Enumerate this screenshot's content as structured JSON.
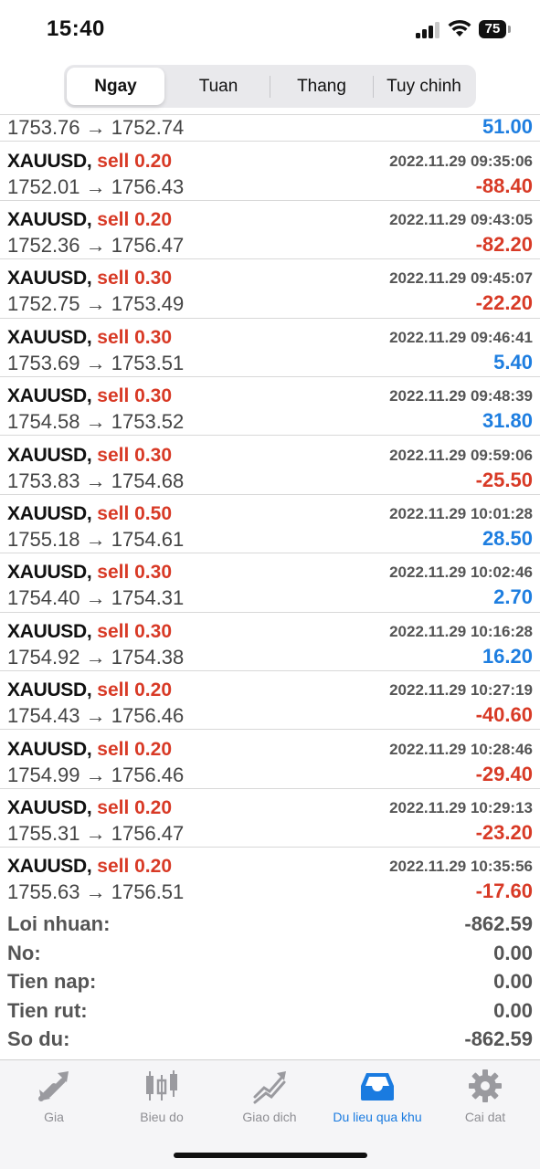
{
  "status": {
    "time": "15:40",
    "battery": "75"
  },
  "segments": [
    "Ngay",
    "Tuan",
    "Thang",
    "Tuy chinh"
  ],
  "partial_row": {
    "prices": "1753.76 → 1752.74",
    "profit": "51.00"
  },
  "deals": [
    {
      "symbol": "XAUUSD,",
      "side": "sell 0.20",
      "time": "2022.11.29 09:35:06",
      "prices": "1752.01 → 1756.43",
      "profit": "-88.40",
      "positive": false
    },
    {
      "symbol": "XAUUSD,",
      "side": "sell 0.20",
      "time": "2022.11.29 09:43:05",
      "prices": "1752.36 → 1756.47",
      "profit": "-82.20",
      "positive": false
    },
    {
      "symbol": "XAUUSD,",
      "side": "sell 0.30",
      "time": "2022.11.29 09:45:07",
      "prices": "1752.75 → 1753.49",
      "profit": "-22.20",
      "positive": false
    },
    {
      "symbol": "XAUUSD,",
      "side": "sell 0.30",
      "time": "2022.11.29 09:46:41",
      "prices": "1753.69 → 1753.51",
      "profit": "5.40",
      "positive": true
    },
    {
      "symbol": "XAUUSD,",
      "side": "sell 0.30",
      "time": "2022.11.29 09:48:39",
      "prices": "1754.58 → 1753.52",
      "profit": "31.80",
      "positive": true
    },
    {
      "symbol": "XAUUSD,",
      "side": "sell 0.30",
      "time": "2022.11.29 09:59:06",
      "prices": "1753.83 → 1754.68",
      "profit": "-25.50",
      "positive": false
    },
    {
      "symbol": "XAUUSD,",
      "side": "sell 0.50",
      "time": "2022.11.29 10:01:28",
      "prices": "1755.18 → 1754.61",
      "profit": "28.50",
      "positive": true
    },
    {
      "symbol": "XAUUSD,",
      "side": "sell 0.30",
      "time": "2022.11.29 10:02:46",
      "prices": "1754.40 → 1754.31",
      "profit": "2.70",
      "positive": true
    },
    {
      "symbol": "XAUUSD,",
      "side": "sell 0.30",
      "time": "2022.11.29 10:16:28",
      "prices": "1754.92 → 1754.38",
      "profit": "16.20",
      "positive": true
    },
    {
      "symbol": "XAUUSD,",
      "side": "sell 0.20",
      "time": "2022.11.29 10:27:19",
      "prices": "1754.43 → 1756.46",
      "profit": "-40.60",
      "positive": false
    },
    {
      "symbol": "XAUUSD,",
      "side": "sell 0.20",
      "time": "2022.11.29 10:28:46",
      "prices": "1754.99 → 1756.46",
      "profit": "-29.40",
      "positive": false
    },
    {
      "symbol": "XAUUSD,",
      "side": "sell 0.20",
      "time": "2022.11.29 10:29:13",
      "prices": "1755.31 → 1756.47",
      "profit": "-23.20",
      "positive": false
    },
    {
      "symbol": "XAUUSD,",
      "side": "sell 0.20",
      "time": "2022.11.29 10:35:56",
      "prices": "1755.63 → 1756.51",
      "profit": "-17.60",
      "positive": false
    }
  ],
  "summary": [
    {
      "label": "Loi nhuan:",
      "value": "-862.59"
    },
    {
      "label": "No:",
      "value": "0.00"
    },
    {
      "label": "Tien nap:",
      "value": "0.00"
    },
    {
      "label": "Tien rut:",
      "value": "0.00"
    },
    {
      "label": "So du:",
      "value": "-862.59"
    }
  ],
  "tabs": [
    {
      "label": "Gia",
      "icon": "price-arrows-icon"
    },
    {
      "label": "Bieu do",
      "icon": "candlestick-icon"
    },
    {
      "label": "Giao dich",
      "icon": "trade-chart-icon"
    },
    {
      "label": "Du lieu qua khu",
      "icon": "history-tray-icon"
    },
    {
      "label": "Cai dat",
      "icon": "gear-icon"
    }
  ],
  "colors": {
    "positive": "#1e7ee0",
    "negative": "#d83a26",
    "active_tab": "#1a7be0",
    "inactive_tab": "#8e8e93"
  }
}
